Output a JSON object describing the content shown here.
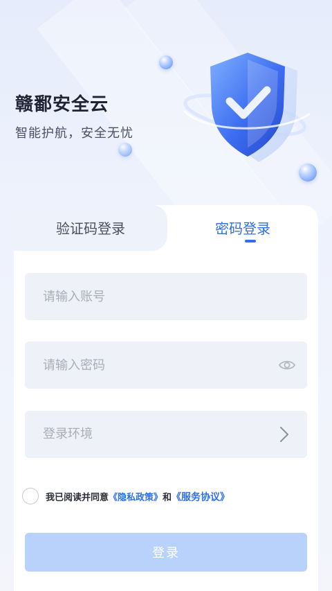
{
  "header": {
    "title": "赣鄱安全云",
    "slogan": "智能护航，安全无忧"
  },
  "tabs": [
    {
      "label": "验证码登录",
      "active": false
    },
    {
      "label": "密码登录",
      "active": true
    }
  ],
  "form": {
    "account_placeholder": "请输入账号",
    "password_placeholder": "请输入密码",
    "environment_label": "登录环境"
  },
  "agreement": {
    "prefix": "我已阅读并同意",
    "privacy_link": "《隐私政策》",
    "conjunction": "和",
    "service_link": "《服务协议》",
    "checked": false
  },
  "login_button_label": "登录",
  "icons": {
    "password_toggle": "eye-icon",
    "environment_arrow": "chevron-right-icon",
    "hero": "shield-check-icon"
  },
  "colors": {
    "accent": "#2f6fe8",
    "button_disabled": "#b9d2fb",
    "field_bg": "#eef1f8"
  }
}
